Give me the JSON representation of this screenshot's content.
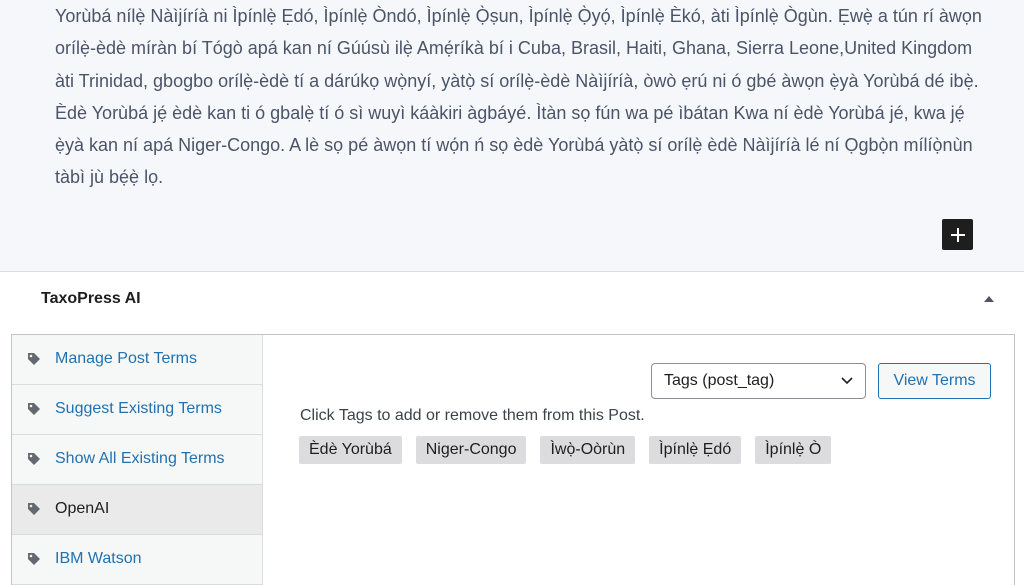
{
  "editor": {
    "paragraph": "Yorùbá nílẹ̀ Nàìjíríà ni Ìpínlẹ̀ Ẹdó, Ìpínlẹ̀ Òndó, Ìpínlẹ̀ Ọ̀ṣun, Ìpínlẹ̀ Ọ̀yọ́, Ìpínlẹ̀ Èkó, àti Ìpínlẹ̀ Ògùn. Ẹwẹ̀ a tún rí àwọn orílẹ̀-èdè míràn bí Tógò apá kan ní Gúúsù ilẹ̀ Amẹ́ríkà bí i Cuba, Brasil, Haiti, Ghana, Sierra Leone,United Kingdom àti Trinidad, gbogbo orílẹ̀-èdè tí a dárúkọ wọ̀nyí, yàtọ̀ sí orílẹ̀-èdè Nàìjíríà, òwò ẹrú ni ó gbé àwọn ẹ̀yà Yorùbá dé ibẹ̀. Èdè Yorùbá jẹ́ èdè kan ti ó gbalẹ̀ tí ó sì wuyì káàkiri àgbáyé. Ìtàn sọ fún wa pé ìbátan Kwa ní èdè Yorùbá jé, kwa jẹ́ ẹ̀yà kan ní apá Niger-Congo. A lè sọ pé àwọn tí wọ́n ń sọ èdè Yorùbá yàtọ̀ sí orílẹ̀ èdè Nàìjíríà lé ní Ọgbọ̀n mílíọ̀nùn tàbì jù bẹ́ẹ̀ lọ.",
    "add_block_icon": "plus-icon"
  },
  "panel": {
    "title": "TaxoPress AI",
    "collapse_icon": "triangle-up-icon"
  },
  "sidebar": {
    "items": [
      {
        "label": "Manage Post Terms",
        "icon": "tag-icon"
      },
      {
        "label": "Suggest Existing Terms",
        "icon": "tag-icon"
      },
      {
        "label": "Show All Existing Terms",
        "icon": "tag-icon"
      },
      {
        "label": "OpenAI",
        "icon": "tag-icon"
      },
      {
        "label": "IBM Watson",
        "icon": "tag-icon"
      }
    ]
  },
  "content": {
    "taxonomy_select": "Tags (post_tag)",
    "view_terms_label": "View Terms",
    "hint": "Click Tags to add or remove them from this Post.",
    "tags": [
      "Èdè Yorùbá",
      "Niger-Congo",
      "Ìwọ̀-Oòrùn",
      "Ìpínlẹ̀ Ẹdó",
      "Ìpínlẹ̀ Ò"
    ]
  },
  "colors": {
    "link": "#2271b1",
    "chip": "#dcdcde",
    "editor_bg": "#f6f7fb"
  }
}
